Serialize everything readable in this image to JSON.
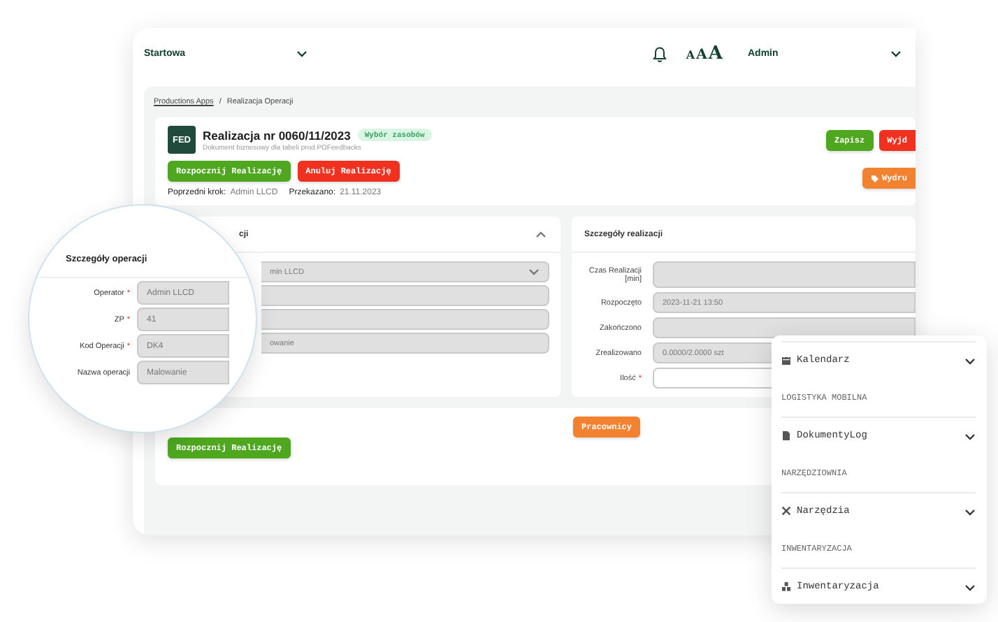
{
  "header": {
    "start_menu": "Startowa",
    "font_size": [
      "A",
      "A",
      "A"
    ],
    "user": "Admin"
  },
  "breadcrumb": {
    "separator": "/",
    "items": [
      {
        "label": "Productions Apps",
        "kind": "link"
      },
      {
        "label": "Realizacja Operacji",
        "kind": "current"
      }
    ]
  },
  "document": {
    "logo": "FED",
    "title": "Realizacja nr 0060/11/2023",
    "status_badge": "Wybór zasobów",
    "subtitle": "Dokument biznesowy dla tabeli prod.POFeedbacks",
    "actions": [
      {
        "label": "Rozpocznij Realizację",
        "kind": "start"
      },
      {
        "label": "Anuluj Realizację",
        "kind": "cancel"
      }
    ],
    "meta": [
      {
        "label": "Poprzedni krok:",
        "value": "Admin LLCD"
      },
      {
        "label": "Przekazano:",
        "value": "21.11.2023"
      }
    ],
    "top_buttons": [
      {
        "label": "Zapisz",
        "kind": "start"
      },
      {
        "label": "Wyjd",
        "kind": "cancel"
      }
    ],
    "print_button": {
      "label": "Wydru",
      "kind": "print"
    }
  },
  "operation_panel": {
    "title": "cji",
    "expanded": true,
    "fields": [
      {
        "kind": "select",
        "value": "min LLCD",
        "disabled": true
      },
      {
        "kind": "input",
        "disabled": true
      },
      {
        "kind": "input",
        "disabled": true
      },
      {
        "kind": "input",
        "value": "owanie",
        "disabled": true
      }
    ]
  },
  "realization_panel": {
    "title": "Szczegóły realizacji",
    "fields": [
      {
        "label": "Czas Realizacji [min]",
        "disabled": true
      },
      {
        "label": "Rozpoczęto",
        "value": "2023-11-21 13:50",
        "disabled": true
      },
      {
        "label": "Zakończono",
        "disabled": true
      },
      {
        "label": "Zrealizowano",
        "value": "0.0000/2.0000 szt",
        "disabled": true
      },
      {
        "label": "Ilość",
        "required_mark": "*",
        "disabled": false
      }
    ]
  },
  "bottom_panel": {
    "buttons": [
      {
        "label": "Pracownicy",
        "kind": "print"
      },
      {
        "label": "Rozpocznij Realizację",
        "kind": "start"
      }
    ]
  },
  "magnifier": {
    "title": "Szczegóły operacji",
    "fields": [
      {
        "label": "Operator",
        "required_mark": "*",
        "value": "Admin LLCD",
        "disabled": true
      },
      {
        "label": "ZP",
        "required_mark": "*",
        "value": "41",
        "disabled": true
      },
      {
        "label": "Kod Operacji",
        "required_mark": "*",
        "value": "DK4",
        "disabled": true
      },
      {
        "label": "Nazwa operacji",
        "value": "Malowanie",
        "disabled": true
      }
    ]
  },
  "menu": {
    "items": [
      {
        "kind": "item",
        "label": "Kalendarz",
        "expanded": false
      },
      {
        "kind": "section",
        "label": "LOGISTYKA MOBILNA"
      },
      {
        "kind": "item",
        "label": "DokumentyLog",
        "expanded": false
      },
      {
        "kind": "section",
        "label": "NARZĘDZIOWNIA"
      },
      {
        "kind": "item",
        "label": "Narzędzia",
        "expanded": false
      },
      {
        "kind": "section",
        "label": "INWENTARYZACJA"
      },
      {
        "kind": "item",
        "label": "Inwentaryzacja",
        "expanded": false
      }
    ]
  }
}
